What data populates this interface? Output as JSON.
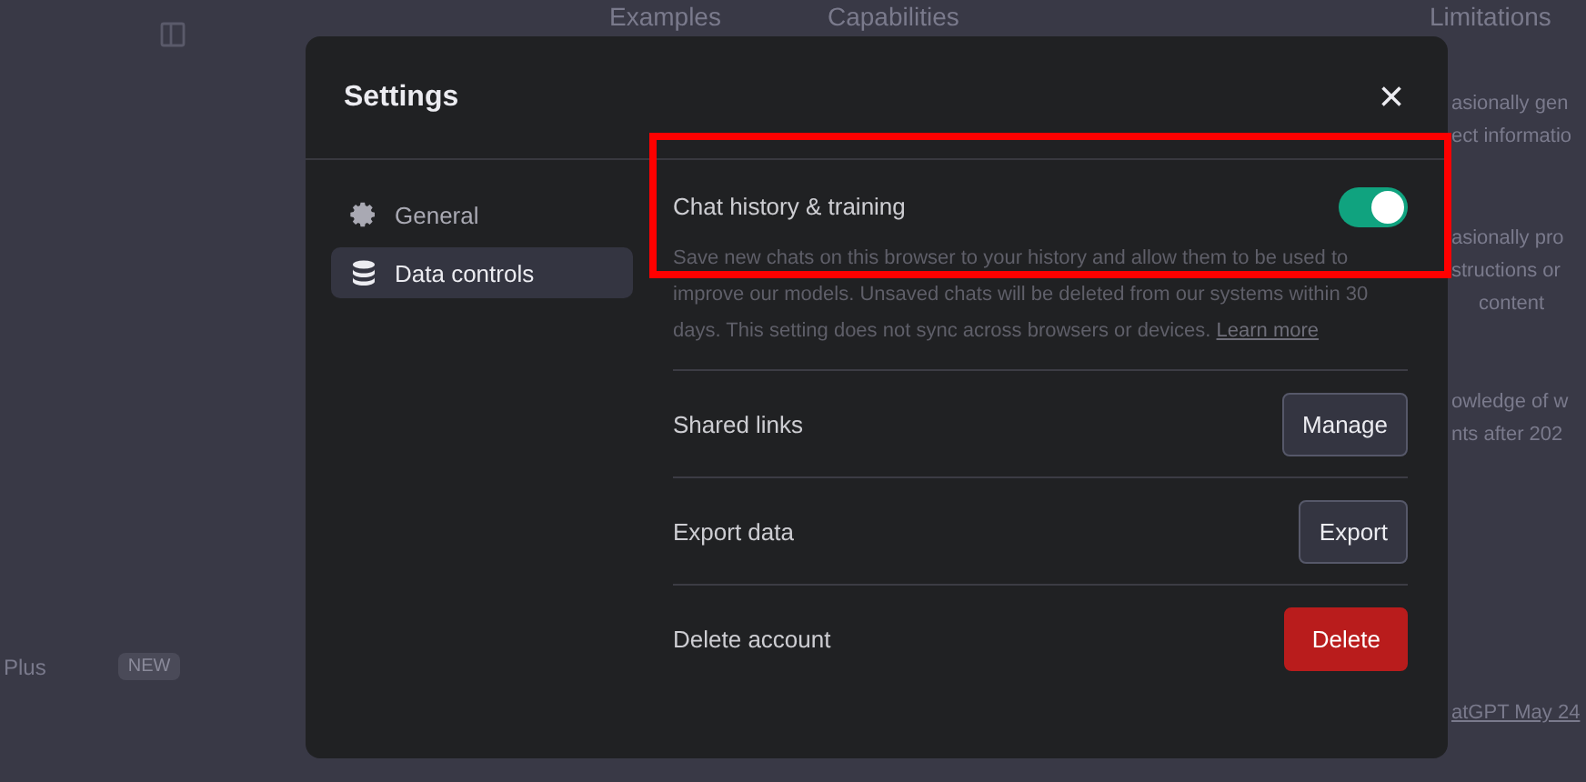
{
  "backdrop": {
    "headings": [
      "Examples",
      "Capabilities",
      "Limitations"
    ],
    "limitations_fragments": [
      "asionally gen",
      "ect informatio",
      "asionally pro",
      "structions or",
      "content",
      "owledge of w",
      "nts after 202"
    ],
    "sidebar_label": "Plus",
    "badge": "NEW",
    "footer_fragment": "atGPT May 24"
  },
  "dialog": {
    "title": "Settings",
    "close": "×",
    "nav": [
      {
        "label": "General",
        "selected": false
      },
      {
        "label": "Data controls",
        "selected": true
      }
    ],
    "history": {
      "label": "Chat history & training",
      "on": true,
      "description": "Save new chats on this browser to your history and allow them to be used to improve our models. Unsaved chats will be deleted from our systems within 30 days. This setting does not sync across browsers or devices.",
      "link": "Learn more"
    },
    "rows": [
      {
        "label": "Shared links",
        "button": "Manage",
        "kind": "normal"
      },
      {
        "label": "Export data",
        "button": "Export",
        "kind": "normal"
      },
      {
        "label": "Delete account",
        "button": "Delete",
        "kind": "danger"
      }
    ]
  },
  "highlight": true
}
